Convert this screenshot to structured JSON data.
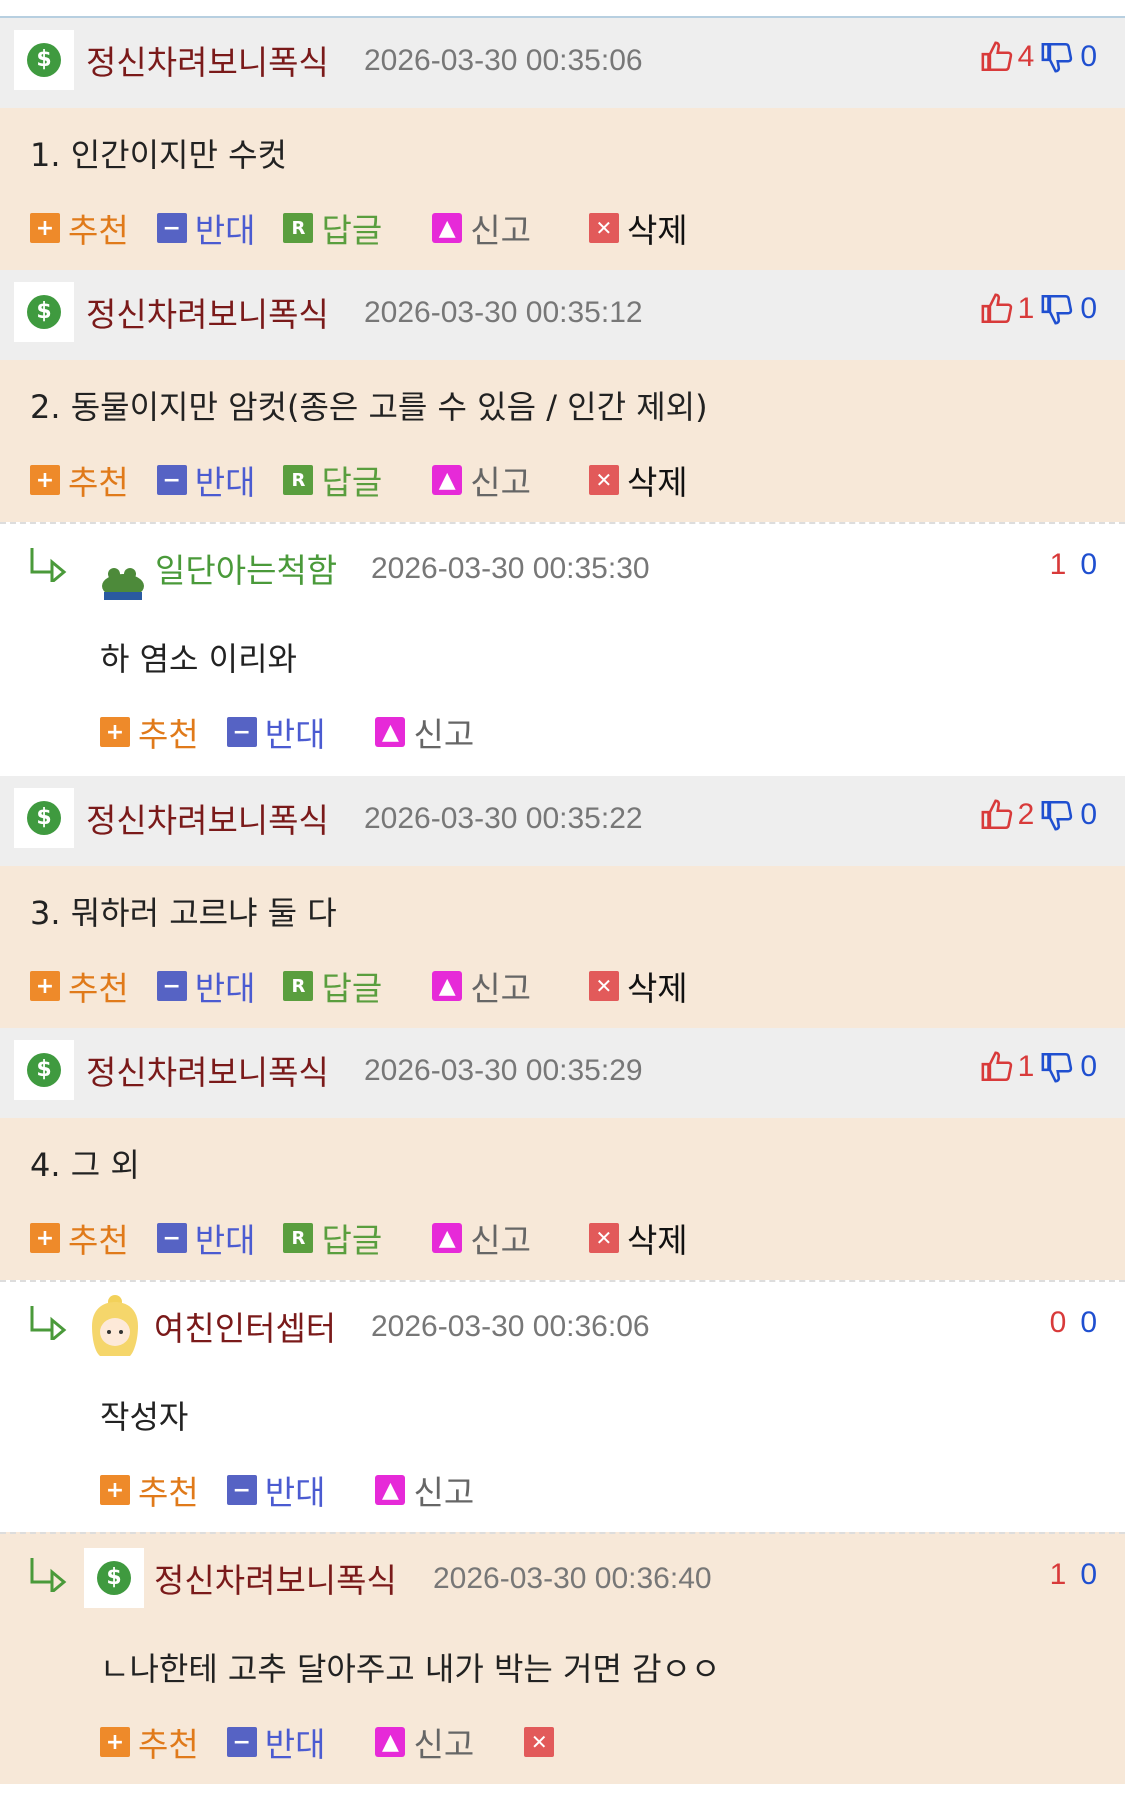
{
  "colors": {
    "up": "#d83a3a",
    "down": "#1f4fd0",
    "nick": "#7a1a1a",
    "nick_green": "#4a9a3a",
    "body_bg": "#f7e8d8",
    "header_bg": "#eeeeee"
  },
  "actions": {
    "recommend": "추천",
    "oppose": "반대",
    "reply": "답글",
    "report": "신고",
    "delete": "삭제"
  },
  "comments": [
    {
      "nick": "정신차려보니폭식",
      "date": "2026-03-30 00:35:06",
      "up": "4",
      "down": "0",
      "text": "1. 인간이지만 수컷"
    },
    {
      "nick": "정신차려보니폭식",
      "date": "2026-03-30 00:35:12",
      "up": "1",
      "down": "0",
      "text": "2. 동물이지만 암컷(종은 고를 수 있음 / 인간 제외)"
    },
    {
      "nick": "일단아는척함",
      "date": "2026-03-30 00:35:30",
      "up": "1",
      "down": "0",
      "text": "하 염소 이리와",
      "avatar": "frog-avatar"
    },
    {
      "nick": "정신차려보니폭식",
      "date": "2026-03-30 00:35:22",
      "up": "2",
      "down": "0",
      "text": "3. 뭐하러 고르냐 둘 다"
    },
    {
      "nick": "정신차려보니폭식",
      "date": "2026-03-30 00:35:29",
      "up": "1",
      "down": "0",
      "text": "4. 그 외"
    },
    {
      "nick": "여친인터셉터",
      "date": "2026-03-30 00:36:06",
      "up": "0",
      "down": "0",
      "text": "작성자",
      "avatar": "anime-girl-avatar"
    },
    {
      "nick": "정신차려보니폭식",
      "date": "2026-03-30 00:36:40",
      "up": "1",
      "down": "0",
      "text": "ㄴ나한테 고추 달아주고 내가 박는 거면 감ㅇㅇ"
    }
  ]
}
